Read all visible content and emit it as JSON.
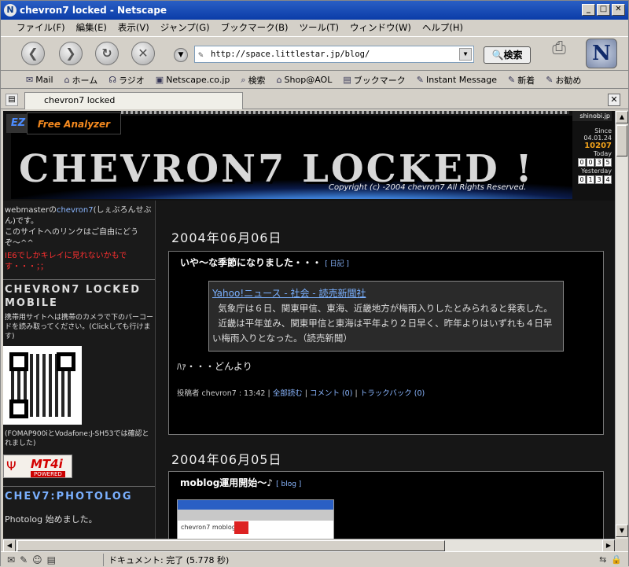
{
  "window": {
    "title": "chevron7 locked - Netscape"
  },
  "menu": [
    "ファイル(F)",
    "編集(E)",
    "表示(V)",
    "ジャンプ(G)",
    "ブックマーク(B)",
    "ツール(T)",
    "ウィンドウ(W)",
    "ヘルプ(H)"
  ],
  "nav": {
    "url": "http://space.littlestar.jp/blog/",
    "search_label": "検索"
  },
  "personal_toolbar": [
    "Mail",
    "ホーム",
    "ラジオ",
    "Netscape.co.jp",
    "検索",
    "Shop@AOL",
    "ブックマーク",
    "Instant Message",
    "新着",
    "お勧め"
  ],
  "tab": {
    "label": "chevron7 locked"
  },
  "banner": {
    "ez": "EZ",
    "analyzer": "Free Analyzer",
    "title": "CHEVRON7 LOCKED !",
    "copyright": "Copyright (c) -2004 chevron7 All Rights Reserved.",
    "counter": {
      "site": "shinobi.jp",
      "since_label": "Since",
      "since_date": "04.01.24",
      "total": "10207",
      "today_label": "Today",
      "today_digits": [
        "0",
        "0",
        "3",
        "5"
      ],
      "yesterday_label": "Yesterday",
      "yesterday_digits": [
        "0",
        "1",
        "3",
        "4"
      ]
    }
  },
  "sidebar": {
    "intro_prefix": "webmasterの",
    "intro_link": "chevron7",
    "intro_suffix": "(しぇぶろんせぶん)です。",
    "intro_line2": "このサイトへのリンクはご自由にどうぞ〜^^",
    "warning": "IE6でしかキレイに見れないかもです・・・；；",
    "mobile_heading": "CHEVRON7 LOCKED MOBILE",
    "mobile_text": "携帯用サイトへは携帯のカメラで下のバーコードを読み取ってください。(Clickしても行けます)",
    "mobile_note": "(FOMAP900iとVodafone:J-SH53では確認とれました)",
    "mt4i_main": "MT4i",
    "mt4i_sub": "POWERED",
    "photolog_heading": "CHEV7:PHOTOLOG",
    "photolog_text": "Photolog 始めました。"
  },
  "entries": [
    {
      "date": "2004年06月06日",
      "title": "いや〜な季節になりました・・・",
      "category": "[ 日記 ]",
      "quote_link": "Yahoo!ニュース - 社会 - 読売新聞社",
      "quote_p1": "気象庁は６日、関東甲信、東海、近畿地方が梅雨入りしたとみられると発表した。",
      "quote_p2": "近畿は平年並み、関東甲信と東海は平年より２日早く、昨年よりはいずれも４日早い梅雨入りとなった。（読売新聞）",
      "body": "ﾊｧ・・・どんより",
      "posted": "投稿者 chevron7 : 13:42",
      "full": "全部読む",
      "comment": "コメント (0)",
      "trackback": "トラックバック (0)"
    },
    {
      "date": "2004年06月05日",
      "title": "moblog運用開始〜♪",
      "category": "[ blog ]",
      "shot_text": "chevron7 moblog"
    }
  ],
  "status": {
    "text": "ドキュメント: 完了 (5.778 秒)"
  }
}
